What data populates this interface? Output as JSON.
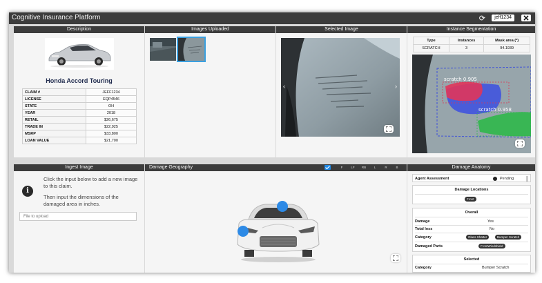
{
  "app": {
    "title": "Cognitive Insurance Platform",
    "user": "jeff1234"
  },
  "description": {
    "header": "Description",
    "car_name": "Honda Accord Touring",
    "specs": [
      {
        "key": "CLAIM #",
        "value": "JEFF1234"
      },
      {
        "key": "LICENSE",
        "value": "EQP4546"
      },
      {
        "key": "STATE",
        "value": "OH"
      },
      {
        "key": "YEAR",
        "value": "2018"
      },
      {
        "key": "RETAIL",
        "value": "$26,675"
      },
      {
        "key": "TRADE IN",
        "value": "$22,925"
      },
      {
        "key": "MSRP",
        "value": "$33,800"
      },
      {
        "key": "LOAN VALUE",
        "value": "$21,700"
      }
    ]
  },
  "images_uploaded": {
    "header": "Images Uploaded"
  },
  "selected_image": {
    "header": "Selected Image"
  },
  "segmentation": {
    "header": "Instance Segmentation",
    "columns": [
      "Type",
      "Instances",
      "Mask area (*)"
    ],
    "rows": [
      [
        "SCRATCH",
        "3",
        "94.1939"
      ]
    ],
    "label_1": "scratch 0.905",
    "label_2": "scratch 0.958"
  },
  "ingest": {
    "header": "Ingest Image",
    "text_1": "Click the input below to add a new image to this claim.",
    "text_2": "Then input the dimensions of the damaged area in inches.",
    "file_placeholder": "File to upload"
  },
  "geography": {
    "header": "Damage Geography",
    "tabs": [
      "F",
      "LF",
      "RB",
      "L",
      "R",
      "B"
    ]
  },
  "anatomy": {
    "header": "Damage Anatomy",
    "agent_label": "Agent Assessment",
    "agent_status": "Pending",
    "locations_title": "Damage Locations",
    "location_chip": "Front",
    "overall_title": "Overall",
    "damage_label": "Damage",
    "damage_value": "Yes",
    "total_loss_label": "Total loss",
    "total_loss_value": "No",
    "category_label": "Category",
    "category_chips": [
      "Glass Shatter",
      "Bumper Scratch"
    ],
    "damaged_parts_label": "Damaged Parts",
    "damaged_parts_chip": "FrontWindshield",
    "selected_title": "Selected",
    "selected_category_label": "Category",
    "selected_category_value": "Bumper Scratch"
  }
}
